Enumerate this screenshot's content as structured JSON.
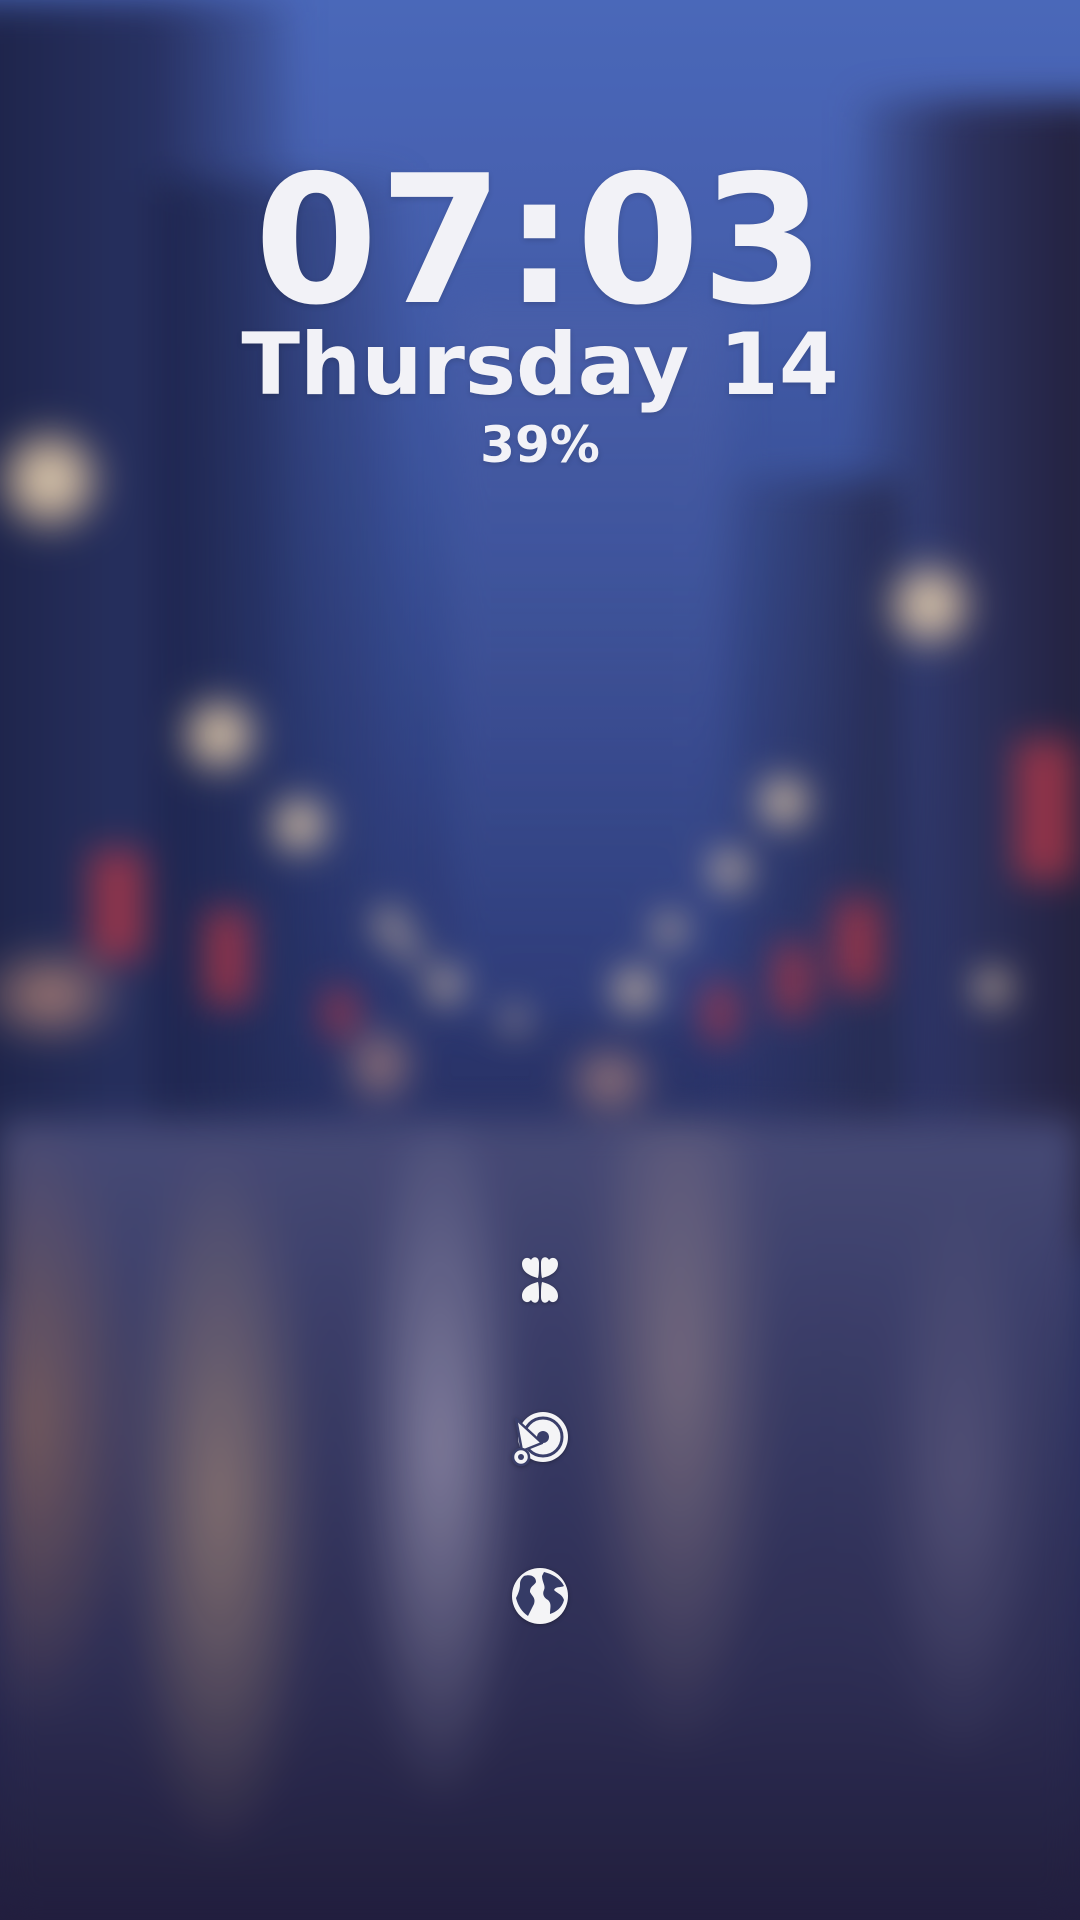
{
  "lockscreen": {
    "time": "07:03",
    "date": "Thursday 14",
    "battery": "39%"
  },
  "shortcuts": [
    {
      "icon": "clover-icon"
    },
    {
      "icon": "music-player-icon"
    },
    {
      "icon": "globe-icon"
    }
  ],
  "colors": {
    "text": "#f2f2f7",
    "sky": "#4f6fc4",
    "street": "#2a2f5e"
  }
}
